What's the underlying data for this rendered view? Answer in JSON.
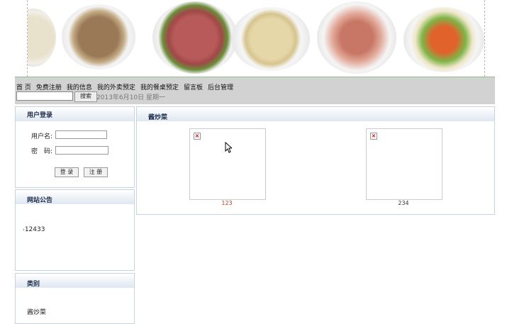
{
  "nav": {
    "links": [
      "首 页",
      "免费注册",
      "我的信息",
      "我的外卖预定",
      "我的餐桌预定",
      "留言板",
      "后台管理"
    ],
    "search_placeholder": "",
    "search_button": "搜索",
    "date": "2013年6月10日 星期一"
  },
  "login": {
    "title": "用户登录",
    "username_label": "用户名:",
    "password_label": "密　码:",
    "login_button": "登 录",
    "register_button": "注 册"
  },
  "notice": {
    "title": "网站公告",
    "items": [
      "12433"
    ]
  },
  "category": {
    "title": "类别",
    "items": [
      "酱炒菜"
    ]
  },
  "main": {
    "title": "酱炒菜",
    "items": [
      {
        "name": "123",
        "name_color": "#c0392b"
      },
      {
        "name": "234",
        "name_color": "#333333"
      }
    ]
  }
}
